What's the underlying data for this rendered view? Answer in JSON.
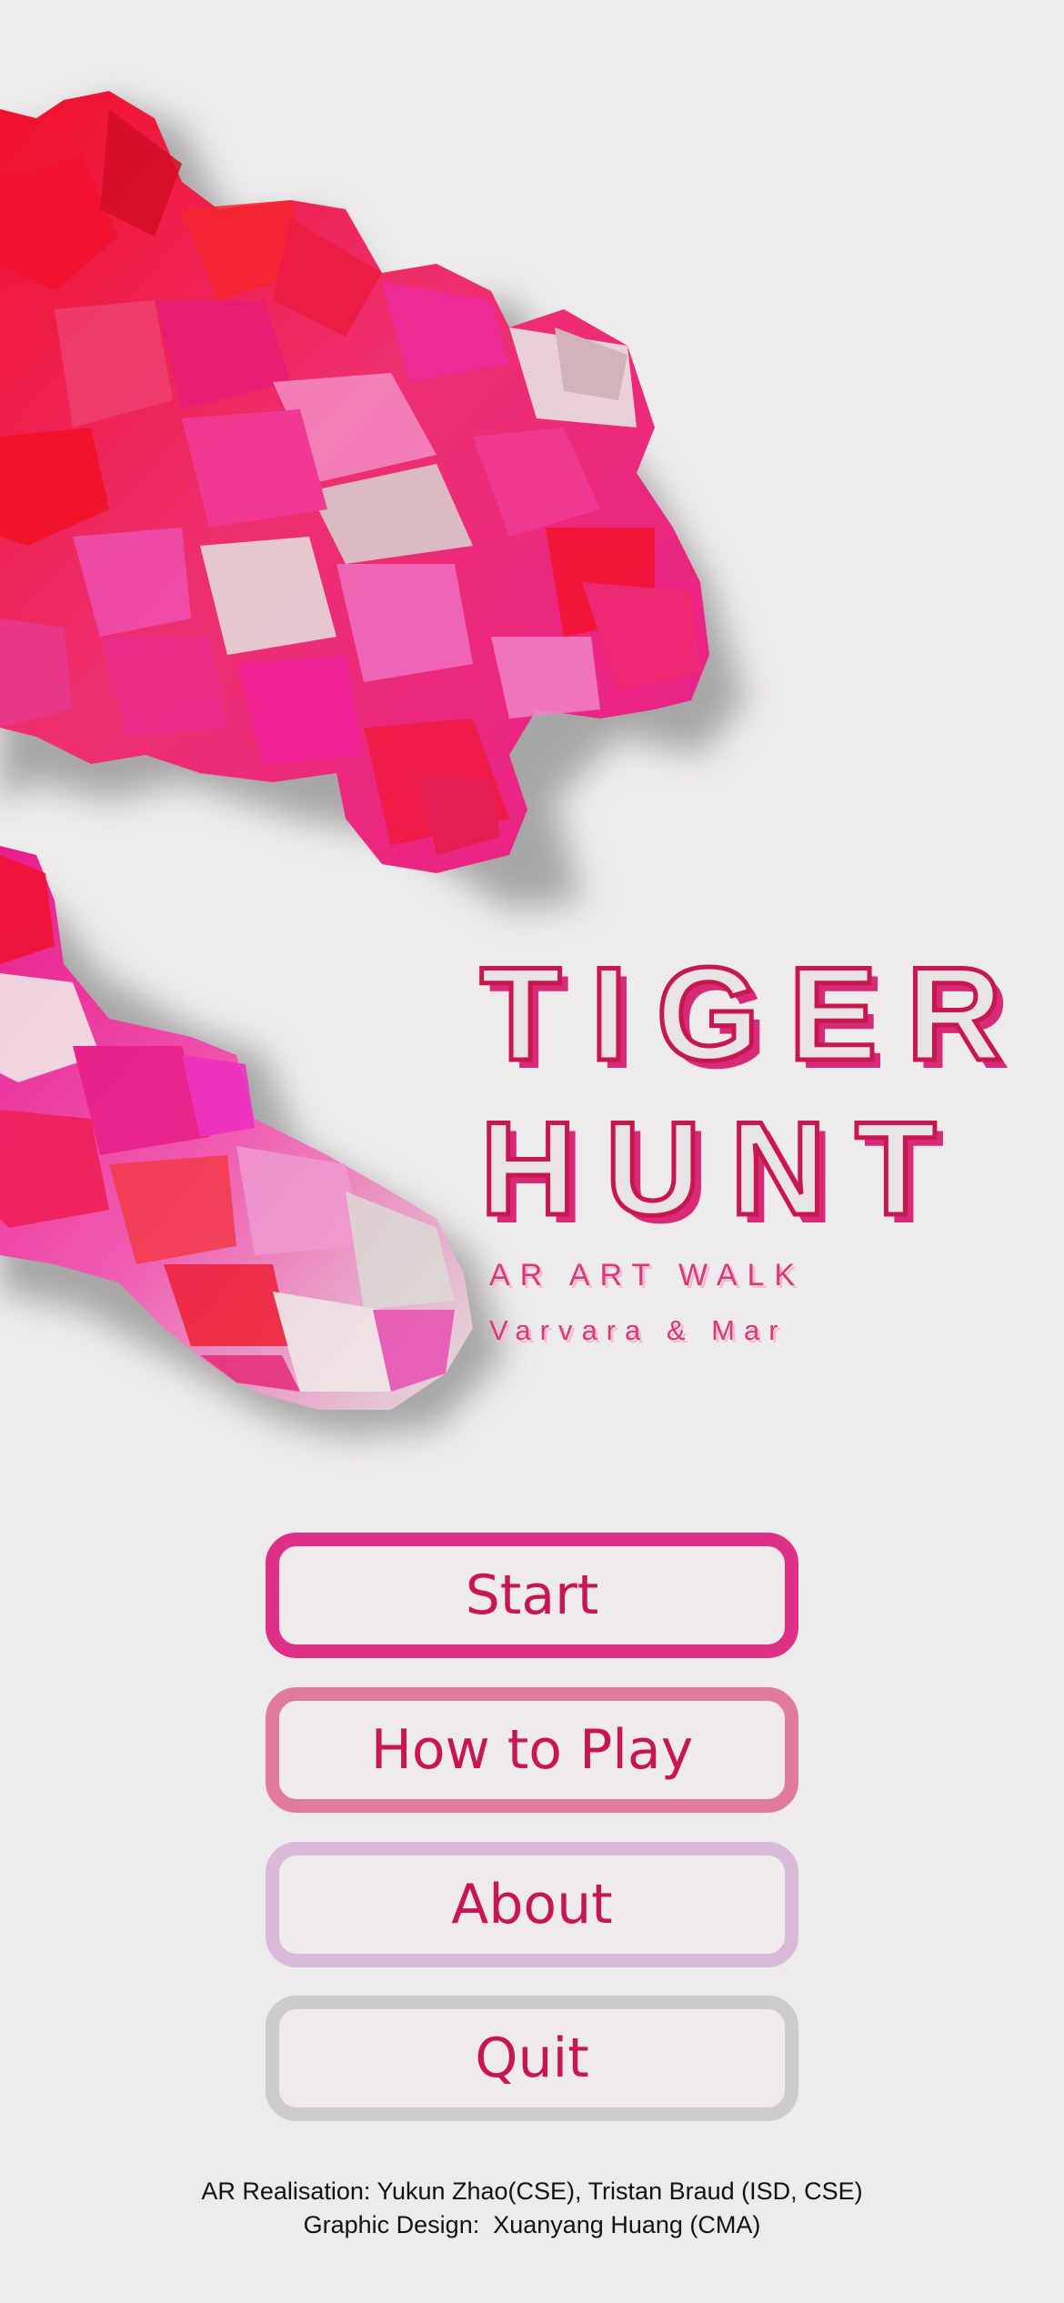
{
  "title": {
    "line1": "TIGER",
    "line2": "HUNT",
    "subtitle": "AR ART WALK",
    "authors": "Varvara & Mar"
  },
  "menu": {
    "start": "Start",
    "how_to_play": "How to Play",
    "about": "About",
    "quit": "Quit"
  },
  "credits": {
    "line1": "AR Realisation: Yukun Zhao(CSE), Tristan Braud (ISD, CSE)",
    "line2": "Graphic Design:  Xuanyang Huang (CMA)"
  },
  "colors": {
    "background": "#eeebec",
    "title_text": "#c8174f",
    "start_border": "#e02f87",
    "how_to_play_border": "#e07a9f",
    "about_border": "#d9bad8",
    "quit_border": "#cdcbcb"
  },
  "icons": {
    "artwork": "low-poly-flower-sculpture"
  }
}
